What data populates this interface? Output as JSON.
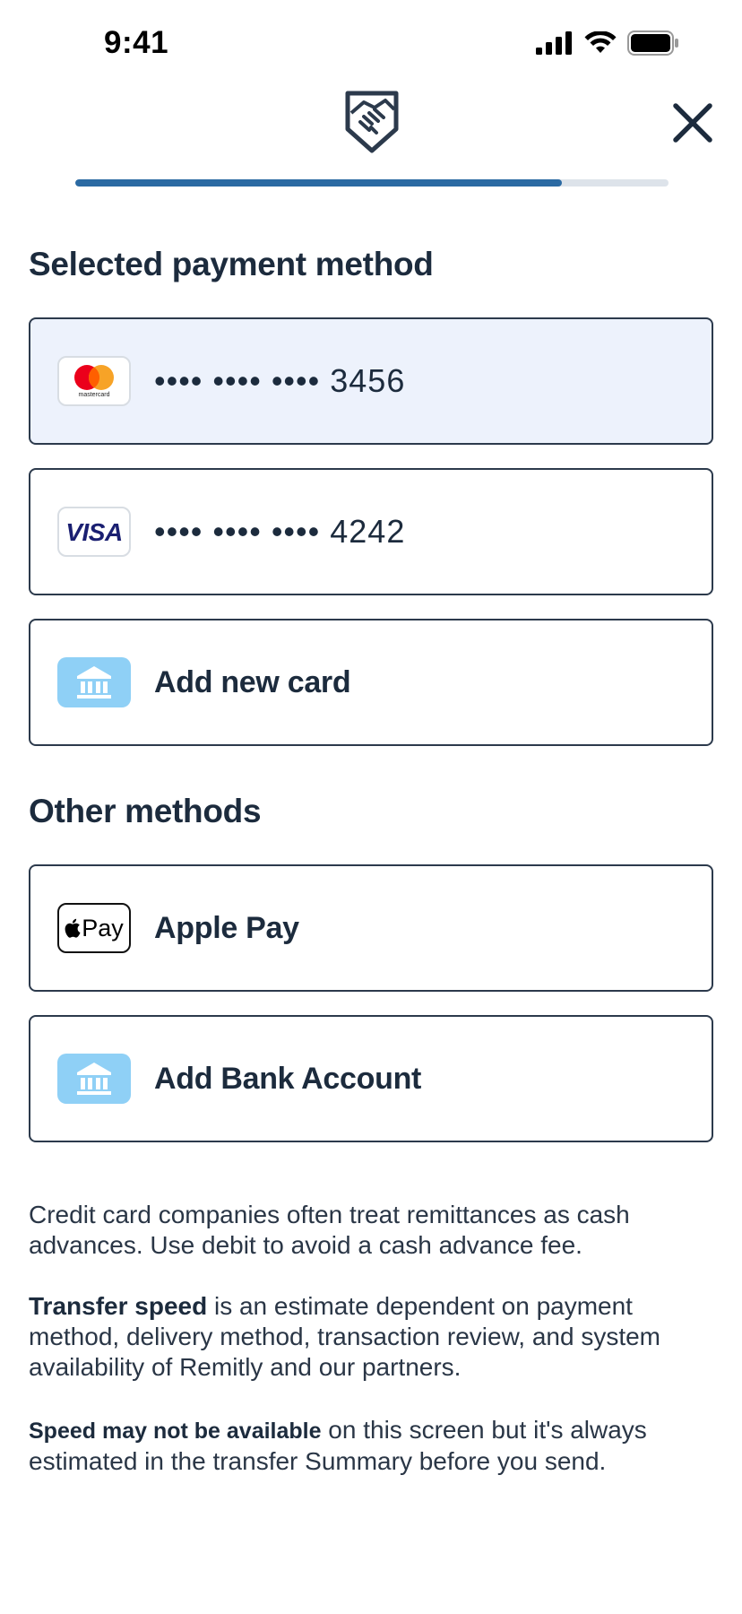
{
  "status_bar": {
    "time": "9:41"
  },
  "progress": {
    "fraction": 0.82
  },
  "selected_section": {
    "title": "Selected payment method"
  },
  "cards": [
    {
      "brand": "mastercard",
      "brand_text": "mastercard",
      "masked_number": "•••• •••• •••• 3456",
      "selected": true
    },
    {
      "brand": "visa",
      "brand_text": "VISA",
      "masked_number": "•••• •••• •••• 4242",
      "selected": false
    }
  ],
  "add_card": {
    "label": "Add new card",
    "icon": "bank-icon"
  },
  "other_section": {
    "title": "Other methods"
  },
  "apple_pay": {
    "label": "Apple Pay",
    "badge_text": "Pay"
  },
  "add_bank": {
    "label": "Add Bank Account",
    "icon": "bank-icon"
  },
  "info": {
    "p1": "Credit card companies often treat remittances as cash advances. Use debit to avoid a cash advance fee.",
    "p2_bold": "Transfer speed",
    "p2_rest": " is an estimate dependent on payment method, delivery method, transaction review, and system availability of Remitly and our partners.",
    "p3_bold": "Speed may not be available",
    "p3_rest": " on this screen but it's always estimated in the transfer Summary before you send."
  },
  "colors": {
    "accent": "#2b6aa3",
    "text": "#1c2b3d",
    "selected_bg": "#edf2fc",
    "bank_icon_bg": "#8fd0f6",
    "mastercard_red": "#eb001b",
    "mastercard_orange": "#f79e1b",
    "visa_blue": "#1a1f71"
  }
}
